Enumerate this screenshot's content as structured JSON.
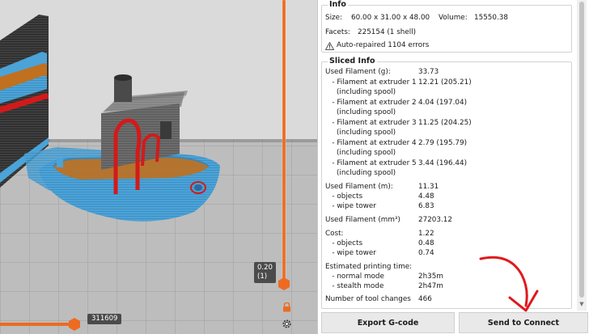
{
  "viewport": {
    "top_layer_label": "0.20\n(1)",
    "bottom_layer_label": "311609"
  },
  "info": {
    "title": "Info",
    "size_label": "Size:",
    "size_value": "60.00 x 31.00 x 48.00",
    "volume_label": "Volume:",
    "volume_value": "15550.38",
    "facets_label": "Facets:",
    "facets_value": "225154 (1 shell)",
    "warning": "Auto-repaired 1104 errors"
  },
  "sliced": {
    "title": "Sliced Info",
    "rows": [
      {
        "label": "Used Filament (g):",
        "value": "33.73"
      },
      {
        "label": "   - Filament at extruder 1",
        "value": "12.21 (205.21)"
      },
      {
        "label": "     (including spool)",
        "value": ""
      },
      {
        "label": "   - Filament at extruder 2",
        "value": "4.04 (197.04)"
      },
      {
        "label": "     (including spool)",
        "value": ""
      },
      {
        "label": "   - Filament at extruder 3",
        "value": "11.25 (204.25)"
      },
      {
        "label": "     (including spool)",
        "value": ""
      },
      {
        "label": "   - Filament at extruder 4",
        "value": "2.79 (195.79)"
      },
      {
        "label": "     (including spool)",
        "value": ""
      },
      {
        "label": "   - Filament at extruder 5",
        "value": "3.44 (196.44)"
      },
      {
        "label": "     (including spool)",
        "value": ""
      },
      {
        "label": "Used Filament (m):",
        "value": "11.31"
      },
      {
        "label": "   - objects",
        "value": "4.48"
      },
      {
        "label": "   - wipe tower",
        "value": "6.83"
      },
      {
        "label": "Used Filament (mm³)",
        "value": "27203.12"
      },
      {
        "label": "Cost:",
        "value": "1.22"
      },
      {
        "label": "   - objects",
        "value": "0.48"
      },
      {
        "label": "   - wipe tower",
        "value": "0.74"
      },
      {
        "label": "Estimated printing time:",
        "value": ""
      },
      {
        "label": "   - normal mode",
        "value": "2h35m"
      },
      {
        "label": "   - stealth mode",
        "value": "2h47m"
      },
      {
        "label": "Number of tool changes",
        "value": "466"
      }
    ]
  },
  "buttons": {
    "export": "Export G-code",
    "connect": "Send to Connect"
  },
  "colors": {
    "accent": "#ed6b21",
    "boat_blue": "#4ba3d8",
    "boat_gray": "#6a6a6a",
    "boat_red": "#d21a1a",
    "boat_orange": "#c0701e",
    "annotation_red": "#e0191c"
  }
}
